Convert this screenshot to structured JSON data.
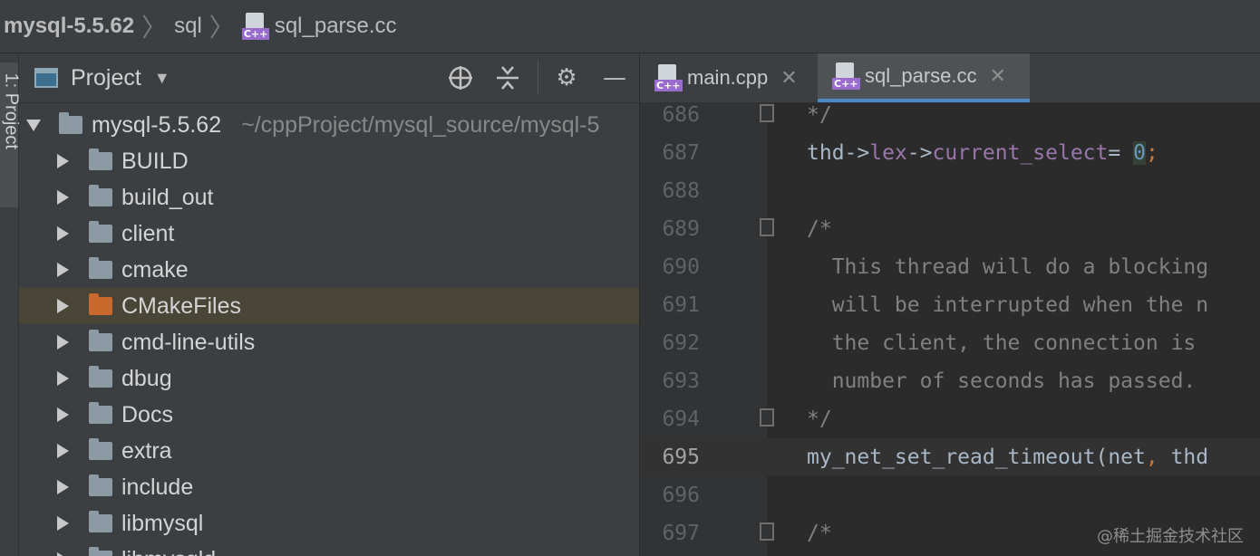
{
  "breadcrumb": {
    "project": "mysql-5.5.62",
    "folder": "sql",
    "file": "sql_parse.cc"
  },
  "tool_strip": {
    "label": "1: Project"
  },
  "project_panel": {
    "title": "Project",
    "icons": [
      "locate-icon",
      "collapse-all-icon",
      "gear-icon",
      "hide-icon"
    ],
    "root": {
      "name": "mysql-5.5.62",
      "path": "~/cppProject/mysql_source/mysql-5"
    },
    "items": [
      {
        "label": "BUILD",
        "color": "#8c9aa4"
      },
      {
        "label": "build_out",
        "color": "#8c9aa4"
      },
      {
        "label": "client",
        "color": "#8c9aa4"
      },
      {
        "label": "cmake",
        "color": "#8c9aa4"
      },
      {
        "label": "CMakeFiles",
        "color": "#c9692d",
        "selected": true
      },
      {
        "label": "cmd-line-utils",
        "color": "#8c9aa4"
      },
      {
        "label": "dbug",
        "color": "#8c9aa4"
      },
      {
        "label": "Docs",
        "color": "#8c9aa4"
      },
      {
        "label": "extra",
        "color": "#8c9aa4"
      },
      {
        "label": "include",
        "color": "#8c9aa4"
      },
      {
        "label": "libmysql",
        "color": "#8c9aa4"
      },
      {
        "label": "libmysqld",
        "color": "#8c9aa4"
      }
    ]
  },
  "editor": {
    "tabs": [
      {
        "label": "main.cpp",
        "active": false
      },
      {
        "label": "sql_parse.cc",
        "active": true
      }
    ],
    "current_line": "695",
    "lines": [
      {
        "num": "686",
        "fold": true,
        "tokens": [
          {
            "t": "*/",
            "c": "t-comment"
          }
        ]
      },
      {
        "num": "687",
        "fold": false,
        "tokens": [
          {
            "t": "thd->",
            "c": "t-plain"
          },
          {
            "t": "lex",
            "c": "t-field"
          },
          {
            "t": "->",
            "c": "t-plain"
          },
          {
            "t": "current_select",
            "c": "t-field"
          },
          {
            "t": "= ",
            "c": "t-plain"
          },
          {
            "t": "0",
            "c": "t-num"
          },
          {
            "t": ";",
            "c": "t-punct"
          }
        ]
      },
      {
        "num": "688",
        "fold": false,
        "tokens": []
      },
      {
        "num": "689",
        "fold": true,
        "tokens": [
          {
            "t": "/*",
            "c": "t-comment"
          }
        ]
      },
      {
        "num": "690",
        "fold": false,
        "tokens": [
          {
            "t": "  This thread will do a blocking",
            "c": "t-comment"
          }
        ]
      },
      {
        "num": "691",
        "fold": false,
        "tokens": [
          {
            "t": "  will be interrupted when the n",
            "c": "t-comment"
          }
        ]
      },
      {
        "num": "692",
        "fold": false,
        "tokens": [
          {
            "t": "  the client, the connection is",
            "c": "t-comment"
          }
        ]
      },
      {
        "num": "693",
        "fold": false,
        "tokens": [
          {
            "t": "  number of seconds has passed.",
            "c": "t-comment"
          }
        ]
      },
      {
        "num": "694",
        "fold": true,
        "tokens": [
          {
            "t": "*/",
            "c": "t-comment"
          }
        ]
      },
      {
        "num": "695",
        "fold": false,
        "tokens": [
          {
            "t": "my_net_set_read_timeout(net",
            "c": "t-plain"
          },
          {
            "t": ", ",
            "c": "t-punct"
          },
          {
            "t": "thd",
            "c": "t-plain"
          }
        ]
      },
      {
        "num": "696",
        "fold": false,
        "tokens": []
      },
      {
        "num": "697",
        "fold": true,
        "tokens": [
          {
            "t": "/*",
            "c": "t-comment"
          }
        ]
      }
    ]
  },
  "watermark": "@稀土掘金技术社区"
}
